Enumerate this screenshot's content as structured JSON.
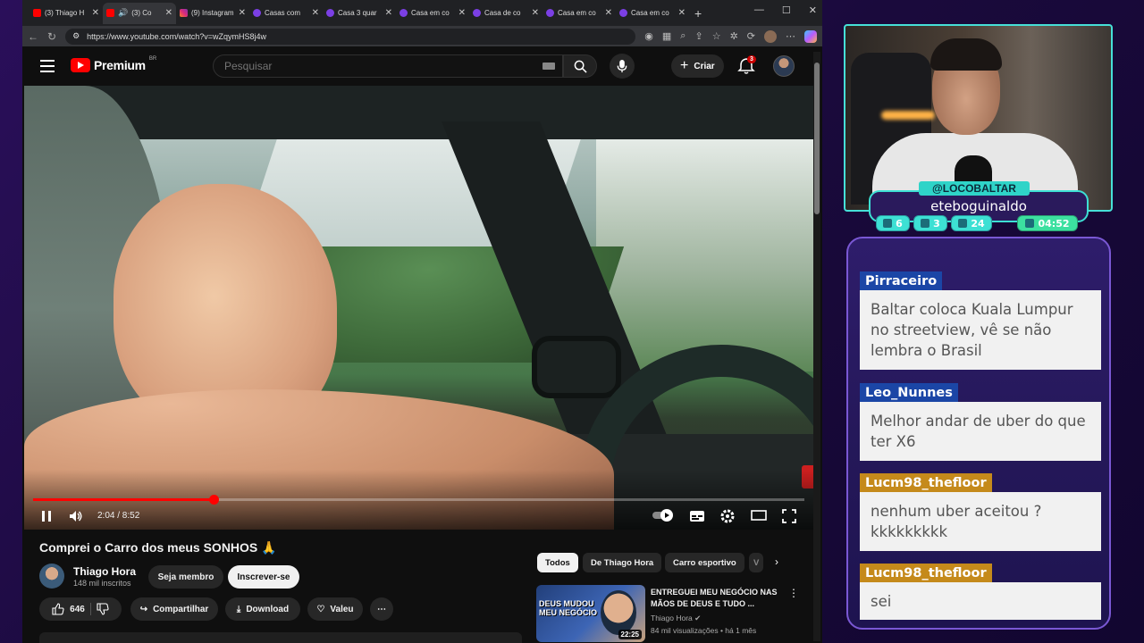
{
  "browser": {
    "tabs": [
      {
        "label": "(3) Thiago H",
        "icon": "youtube-icon",
        "active": false
      },
      {
        "label": "(3) Co",
        "icon": "youtube-icon",
        "active": true,
        "audio": true
      },
      {
        "label": "(9) Instagram",
        "icon": "instagram-icon",
        "active": false
      },
      {
        "label": "Casas com",
        "icon": "chaves-icon",
        "active": false
      },
      {
        "label": "Casa 3 quar",
        "icon": "chaves-icon",
        "active": false
      },
      {
        "label": "Casa em co",
        "icon": "chaves-icon",
        "active": false
      },
      {
        "label": "Casa de co",
        "icon": "chaves-icon",
        "active": false
      },
      {
        "label": "Casa em co",
        "icon": "chaves-icon",
        "active": false
      },
      {
        "label": "Casa em co",
        "icon": "chaves-icon",
        "active": false
      }
    ],
    "url": "https://www.youtube.com/watch?v=wZqymHS8j4w"
  },
  "youtube": {
    "logo_text": "Premium",
    "region": "BR",
    "search_placeholder": "Pesquisar",
    "create_label": "Criar",
    "notification_count": "3",
    "player": {
      "time_display": "2:04 / 8:52",
      "progress": 0.234
    },
    "video": {
      "title": "Comprei o Carro dos meus SONHOS 🙏",
      "channel": "Thiago Hora",
      "subscribers": "148 mil inscritos",
      "member_label": "Seja membro",
      "subscribe_label": "Inscrever-se",
      "likes": "646",
      "share_label": "Compartilhar",
      "download_label": "Download",
      "thanks_label": "Valeu"
    },
    "chips": [
      "Todos",
      "De Thiago Hora",
      "Carro esportivo",
      "V"
    ],
    "recommendation": {
      "thumb_text": "DEUS MUDOU MEU NEGÓCIO",
      "duration": "22:25",
      "title": "ENTREGUEI MEU NEGÓCIO NAS MÃOS DE DEUS E TUDO ...",
      "channel": "Thiago Hora",
      "meta": "84 mil visualizações • há 1 mês"
    }
  },
  "overlay": {
    "handle": "@LOCOBALTAR",
    "viewer_name": "eteboguinaldo",
    "stats": {
      "a": "6",
      "b": "3",
      "c": "24",
      "time": "04:52"
    },
    "chat": [
      {
        "user": "Pirraceiro",
        "text": "Baltar coloca Kuala Lumpur no streetview, vê se não lembra o Brasil",
        "color": "#1b46a6"
      },
      {
        "user": "Leo_Nunnes",
        "text": "Melhor andar de uber do que ter X6",
        "color": "#1b46a6"
      },
      {
        "user": "Lucm98_thefloor",
        "text": "nenhum uber aceitou ? kkkkkkkkk",
        "color": "#c58a1b"
      },
      {
        "user": "Lucm98_thefloor",
        "text": "sei",
        "color": "#c58a1b"
      }
    ]
  }
}
